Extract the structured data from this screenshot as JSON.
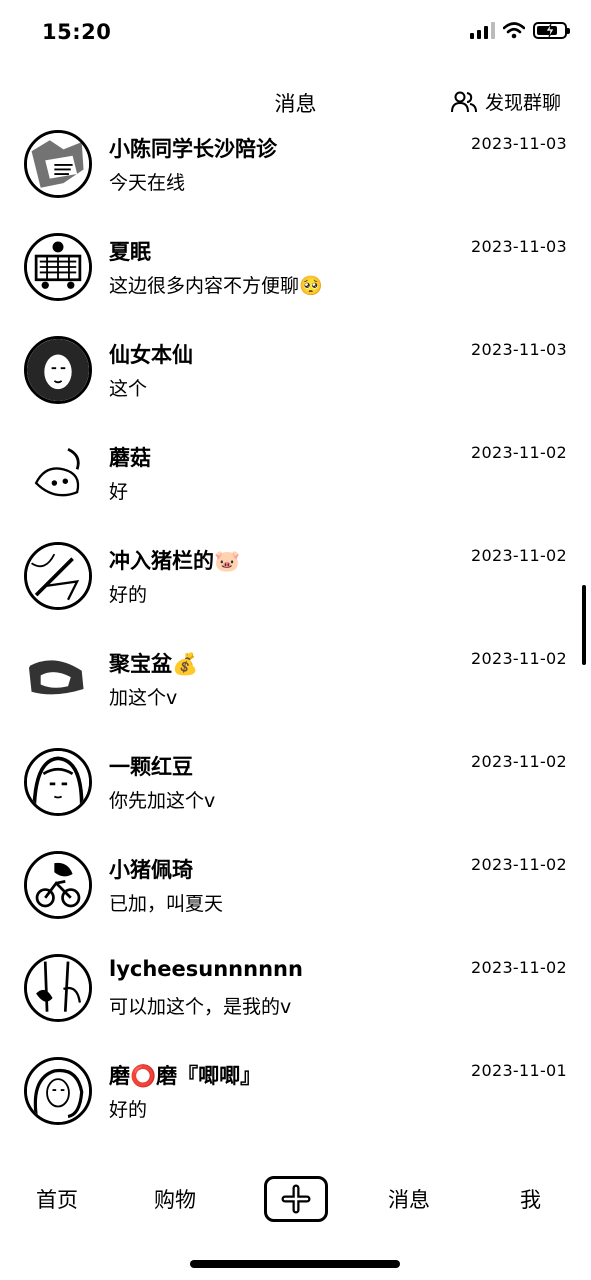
{
  "status_bar": {
    "time": "15:20"
  },
  "header": {
    "title": "消息",
    "discover_label": "发现群聊"
  },
  "chats": [
    {
      "name": "小陈同学长沙陪诊",
      "preview": "今天在线",
      "time": "2023-11-03"
    },
    {
      "name": "夏眠",
      "preview": "这边很多内容不方便聊🥺",
      "time": "2023-11-03"
    },
    {
      "name": "仙女本仙",
      "preview": "这个",
      "time": "2023-11-03"
    },
    {
      "name": "蘑菇",
      "preview": "好",
      "time": "2023-11-02"
    },
    {
      "name": "冲入猪栏的🐷",
      "preview": "好的",
      "time": "2023-11-02"
    },
    {
      "name": "聚宝盆💰",
      "preview": "加这个v",
      "time": "2023-11-02"
    },
    {
      "name": "一颗红豆",
      "preview": "你先加这个v",
      "time": "2023-11-02"
    },
    {
      "name": "小猪佩琦",
      "preview": "已加，叫夏天",
      "time": "2023-11-02"
    },
    {
      "name": "lycheesunnnnnn",
      "preview": "可以加这个，是我的v",
      "time": "2023-11-02"
    },
    {
      "name": "磨⭕磨『唧唧』",
      "preview": "好的",
      "time": "2023-11-01"
    }
  ],
  "tab_bar": {
    "home": "首页",
    "shop": "购物",
    "add_icon": "plus-icon",
    "messages": "消息",
    "me": "我"
  }
}
